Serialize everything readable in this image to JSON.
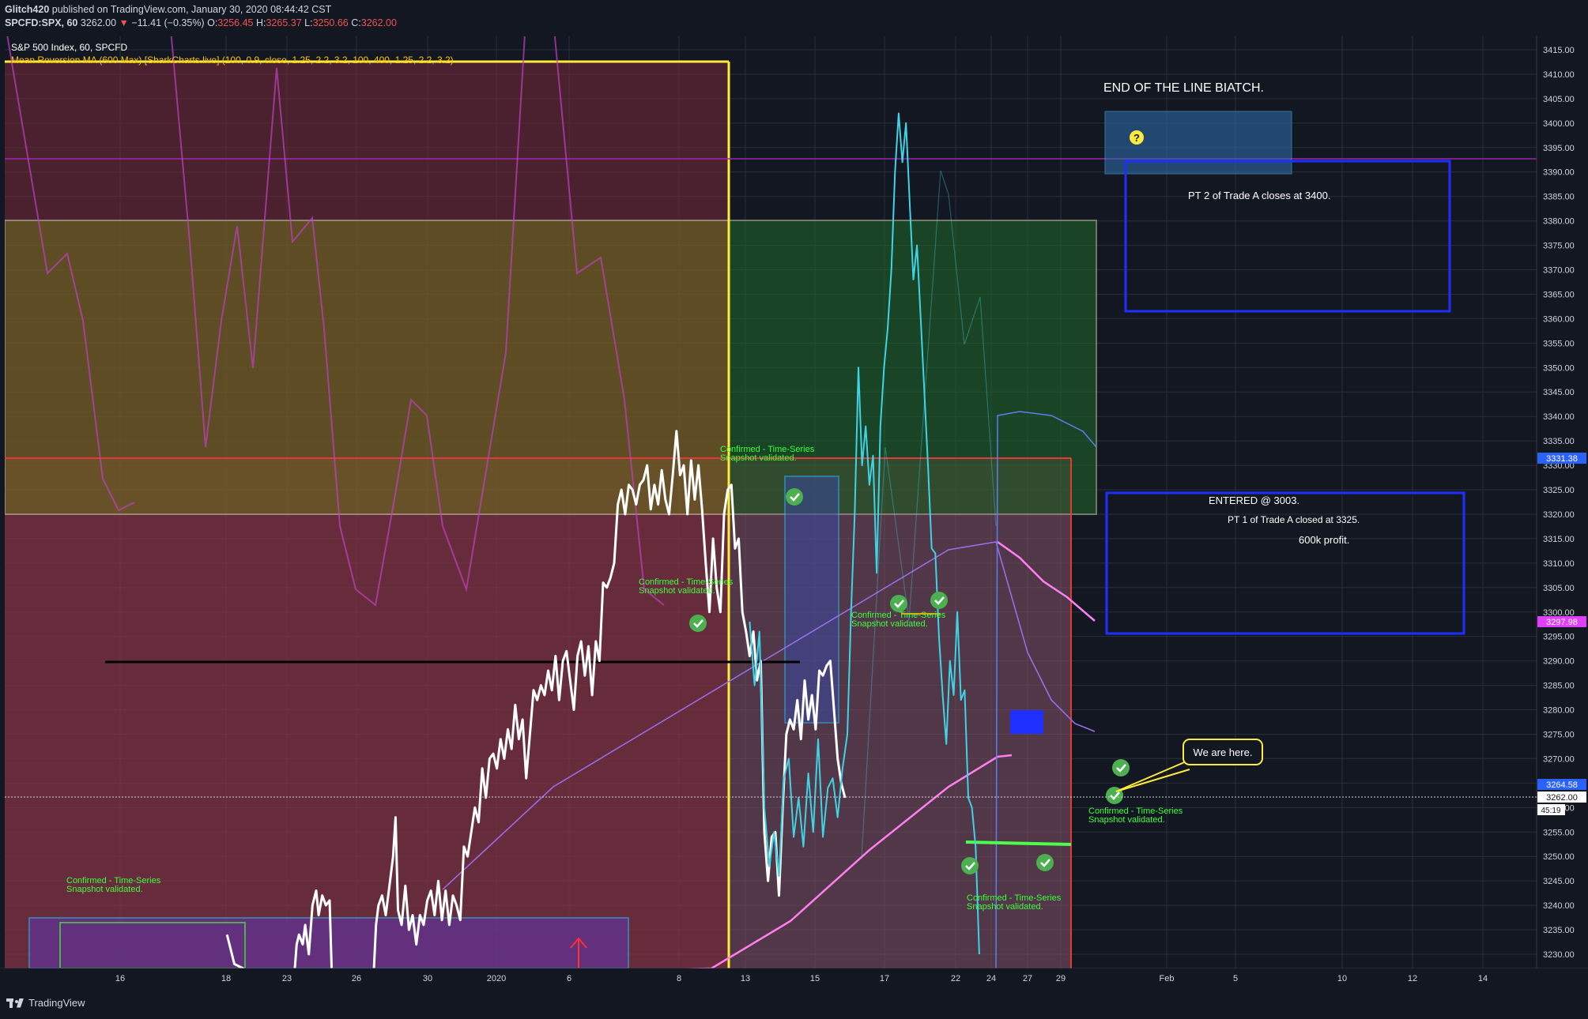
{
  "header": {
    "author": "Glitch420",
    "published": "published on TradingView.com, January 30, 2020 08:44:42 CST",
    "symbol": "SPCFD:SPX, 60",
    "last": "3262.00",
    "down_arrow": "▼",
    "change": "−11.41 (−0.35%)",
    "o_label": "O:",
    "o": "3256.45",
    "h_label": "H:",
    "h": "3265.37",
    "l_label": "L:",
    "l": "3250.66",
    "c_label": "C:",
    "c": "3262.00"
  },
  "legend": {
    "series": "S&P 500 Index, 60, SPCFD",
    "indicator": "Mean Reversion MA (600 Max) [SharkCharts.live] (100, 0.9, close, 1.25, 2.2, 3.2, 100, 400, 1.25, 2.2, 3.2)"
  },
  "annotations": {
    "end_of_line": "END OF THE LINE BIATCH.",
    "pt2": "PT 2 of Trade A closes at 3400.",
    "entered": "ENTERED @ 3003.",
    "pt1": "PT 1 of Trade A closed at 3325.",
    "profit": "600k profit.",
    "we_are_here": "We are here.",
    "question": "?",
    "confirmed_1": "Confirmed - Time-Series",
    "confirmed_2": "Snapshot validated."
  },
  "price_badges": {
    "b1": "3331.38",
    "b2": "3297.98",
    "b3": "3264.58",
    "b4": "3262.00",
    "countdown": "45:19"
  },
  "footer": {
    "brand": "TradingView"
  },
  "colors": {
    "price": "#ffffff",
    "forecast": "#3fd3e6",
    "background": "#131722",
    "badge_blue": "#2962ff",
    "badge_pink": "#e040fb",
    "zone_red": "#7a2a3a",
    "zone_green": "#1e5a2a",
    "zone_olive": "#5a5a22",
    "yellow": "#ffeb3b"
  },
  "chart_data": {
    "type": "line",
    "ylim": [
      3226,
      3418
    ],
    "y_ticks": [
      "3230.00",
      "3235.00",
      "3240.00",
      "3245.00",
      "3250.00",
      "3255.00",
      "3260.00",
      "3265.00",
      "3270.00",
      "3275.00",
      "3280.00",
      "3285.00",
      "3290.00",
      "3295.00",
      "3300.00",
      "3305.00",
      "3310.00",
      "3315.00",
      "3320.00",
      "3325.00",
      "3330.00",
      "3335.00",
      "3340.00",
      "3345.00",
      "3350.00",
      "3355.00",
      "3360.00",
      "3365.00",
      "3370.00",
      "3375.00",
      "3380.00",
      "3385.00",
      "3390.00",
      "3395.00",
      "3400.00",
      "3405.00",
      "3410.00",
      "3415.00"
    ],
    "x_ticks": [
      "16",
      "18",
      "23",
      "26",
      "30",
      "2020",
      "6",
      "8",
      "13",
      "15",
      "17",
      "22",
      "24",
      "27",
      "29",
      "Feb",
      "5",
      "10",
      "12",
      "14"
    ],
    "series": [
      {
        "values": [
          [
            18.2,
            3234
          ],
          [
            18.8,
            3228
          ],
          [
            23.6,
            3222
          ],
          [
            23.9,
            3232
          ],
          [
            24.1,
            3234
          ],
          [
            24.4,
            3232
          ],
          [
            24.6,
            3236
          ],
          [
            24.9,
            3230
          ],
          [
            25.2,
            3240
          ],
          [
            25.5,
            3243
          ],
          [
            25.7,
            3238
          ],
          [
            26.0,
            3242
          ],
          [
            26.3,
            3240
          ],
          [
            26.6,
            3241
          ],
          [
            26.8,
            3224
          ],
          [
            30.1,
            3220
          ],
          [
            30.4,
            3236
          ],
          [
            30.6,
            3240
          ],
          [
            30.9,
            3242
          ],
          [
            31.2,
            3238
          ],
          [
            31.5,
            3244
          ],
          [
            31.8,
            3250
          ],
          [
            32.0,
            3258
          ],
          [
            32.2,
            3239
          ],
          [
            32.5,
            3236
          ],
          [
            32.8,
            3244
          ],
          [
            33.1,
            3235
          ],
          [
            33.4,
            3238
          ],
          [
            33.7,
            3232
          ],
          [
            34.0,
            3238
          ],
          [
            34.3,
            3236
          ],
          [
            34.6,
            3241
          ],
          [
            34.9,
            3243
          ],
          [
            35.2,
            3238
          ],
          [
            35.5,
            3245
          ],
          [
            35.8,
            3237
          ],
          [
            36.1,
            3243
          ],
          [
            36.4,
            3236
          ],
          [
            36.7,
            3242
          ],
          [
            37.0,
            3240
          ],
          [
            37.3,
            3237
          ],
          [
            37.6,
            3252
          ],
          [
            37.9,
            3250
          ],
          [
            38.2,
            3255
          ],
          [
            38.5,
            3260
          ],
          [
            38.8,
            3257
          ],
          [
            39.1,
            3268
          ],
          [
            39.4,
            3262
          ],
          [
            39.7,
            3270
          ],
          [
            40.0,
            3271
          ],
          [
            40.3,
            3268
          ],
          [
            40.6,
            3274
          ],
          [
            40.9,
            3270
          ],
          [
            41.2,
            3276
          ],
          [
            41.5,
            3272
          ],
          [
            41.8,
            3281
          ],
          [
            42.1,
            3274
          ],
          [
            42.4,
            3278
          ],
          [
            42.7,
            3266
          ],
          [
            43.0,
            3275
          ],
          [
            43.3,
            3284
          ],
          [
            43.6,
            3282
          ],
          [
            43.9,
            3285
          ],
          [
            44.2,
            3283
          ],
          [
            44.5,
            3288
          ],
          [
            44.8,
            3284
          ],
          [
            45.1,
            3291
          ],
          [
            45.4,
            3282
          ],
          [
            45.7,
            3290
          ],
          [
            46.0,
            3292
          ],
          [
            46.3,
            3286
          ],
          [
            46.6,
            3280
          ],
          [
            46.9,
            3291
          ],
          [
            47.2,
            3294
          ],
          [
            47.5,
            3287
          ],
          [
            47.8,
            3293
          ],
          [
            48.1,
            3283
          ],
          [
            48.4,
            3294
          ],
          [
            48.7,
            3290
          ],
          [
            49.0,
            3306
          ],
          [
            49.3,
            3305
          ],
          [
            49.6,
            3307
          ],
          [
            49.9,
            3310
          ],
          [
            50.2,
            3322
          ],
          [
            50.5,
            3325
          ],
          [
            50.8,
            3320
          ],
          [
            51.1,
            3326
          ],
          [
            51.4,
            3325
          ],
          [
            51.7,
            3322
          ],
          [
            52.0,
            3326
          ],
          [
            52.3,
            3327
          ],
          [
            52.6,
            3330
          ],
          [
            52.9,
            3321
          ],
          [
            53.2,
            3326
          ],
          [
            53.5,
            3322
          ],
          [
            53.8,
            3329
          ],
          [
            54.1,
            3323
          ],
          [
            54.4,
            3320
          ],
          [
            54.7,
            3328
          ],
          [
            55.0,
            3337
          ],
          [
            55.3,
            3328
          ],
          [
            55.6,
            3330
          ],
          [
            55.9,
            3320
          ],
          [
            56.2,
            3331
          ],
          [
            56.5,
            3323
          ],
          [
            56.8,
            3330
          ],
          [
            57.1,
            3321
          ],
          [
            57.4,
            3310
          ],
          [
            57.7,
            3300
          ],
          [
            58.0,
            3315
          ],
          [
            58.3,
            3305
          ],
          [
            58.6,
            3300
          ],
          [
            58.9,
            3320
          ],
          [
            59.2,
            3325
          ],
          [
            59.5,
            3326
          ],
          [
            59.8,
            3313
          ],
          [
            60.1,
            3315
          ],
          [
            60.4,
            3300
          ],
          [
            60.7,
            3296
          ],
          [
            61.0,
            3291
          ],
          [
            61.3,
            3296
          ],
          [
            61.6,
            3286
          ],
          [
            61.9,
            3290
          ],
          [
            62.2,
            3255
          ],
          [
            62.5,
            3245
          ],
          [
            62.8,
            3254
          ],
          [
            63.1,
            3255
          ],
          [
            63.4,
            3242
          ],
          [
            63.7,
            3260
          ],
          [
            64.0,
            3275
          ],
          [
            64.3,
            3278
          ],
          [
            64.6,
            3276
          ],
          [
            64.9,
            3282
          ],
          [
            65.2,
            3274
          ],
          [
            65.5,
            3286
          ],
          [
            65.8,
            3278
          ],
          [
            66.1,
            3283
          ],
          [
            66.4,
            3276
          ],
          [
            66.7,
            3288
          ],
          [
            67.0,
            3287
          ],
          [
            67.3,
            3289
          ],
          [
            67.6,
            3290
          ],
          [
            67.9,
            3280
          ],
          [
            68.2,
            3270
          ],
          [
            68.5,
            3265
          ],
          [
            68.8,
            3262
          ]
        ]
      },
      {
        "values": [
          [
            61.0,
            3298
          ],
          [
            61.4,
            3285
          ],
          [
            61.8,
            3296
          ],
          [
            62.2,
            3260
          ],
          [
            62.6,
            3248
          ],
          [
            63.0,
            3255
          ],
          [
            63.4,
            3246
          ],
          [
            63.8,
            3266
          ],
          [
            64.2,
            3270
          ],
          [
            64.6,
            3254
          ],
          [
            65.0,
            3262
          ],
          [
            65.4,
            3252
          ],
          [
            65.8,
            3267
          ],
          [
            66.2,
            3255
          ],
          [
            66.6,
            3274
          ],
          [
            67.0,
            3254
          ],
          [
            67.4,
            3264
          ],
          [
            67.8,
            3266
          ],
          [
            68.2,
            3258
          ],
          [
            68.6,
            3268
          ],
          [
            69.0,
            3275
          ],
          [
            69.3,
            3300
          ],
          [
            69.6,
            3320
          ],
          [
            69.9,
            3350
          ],
          [
            70.2,
            3330
          ],
          [
            70.5,
            3338
          ],
          [
            70.8,
            3326
          ],
          [
            71.1,
            3332
          ],
          [
            71.4,
            3308
          ],
          [
            71.7,
            3338
          ],
          [
            72.0,
            3350
          ],
          [
            72.3,
            3358
          ],
          [
            72.6,
            3370
          ],
          [
            72.9,
            3390
          ],
          [
            73.2,
            3402
          ],
          [
            73.5,
            3392
          ],
          [
            73.8,
            3400
          ],
          [
            74.1,
            3384
          ],
          [
            74.4,
            3368
          ],
          [
            74.7,
            3375
          ],
          [
            75.0,
            3360
          ],
          [
            75.3,
            3345
          ],
          [
            75.6,
            3330
          ],
          [
            75.9,
            3313
          ],
          [
            76.2,
            3312
          ],
          [
            76.5,
            3295
          ],
          [
            76.8,
            3283
          ],
          [
            77.1,
            3273
          ],
          [
            77.4,
            3290
          ],
          [
            77.7,
            3283
          ],
          [
            78.0,
            3300
          ],
          [
            78.3,
            3282
          ],
          [
            78.6,
            3284
          ],
          [
            78.9,
            3262
          ],
          [
            79.2,
            3260
          ],
          [
            79.5,
            3252
          ],
          [
            79.8,
            3230
          ]
        ]
      }
    ]
  }
}
